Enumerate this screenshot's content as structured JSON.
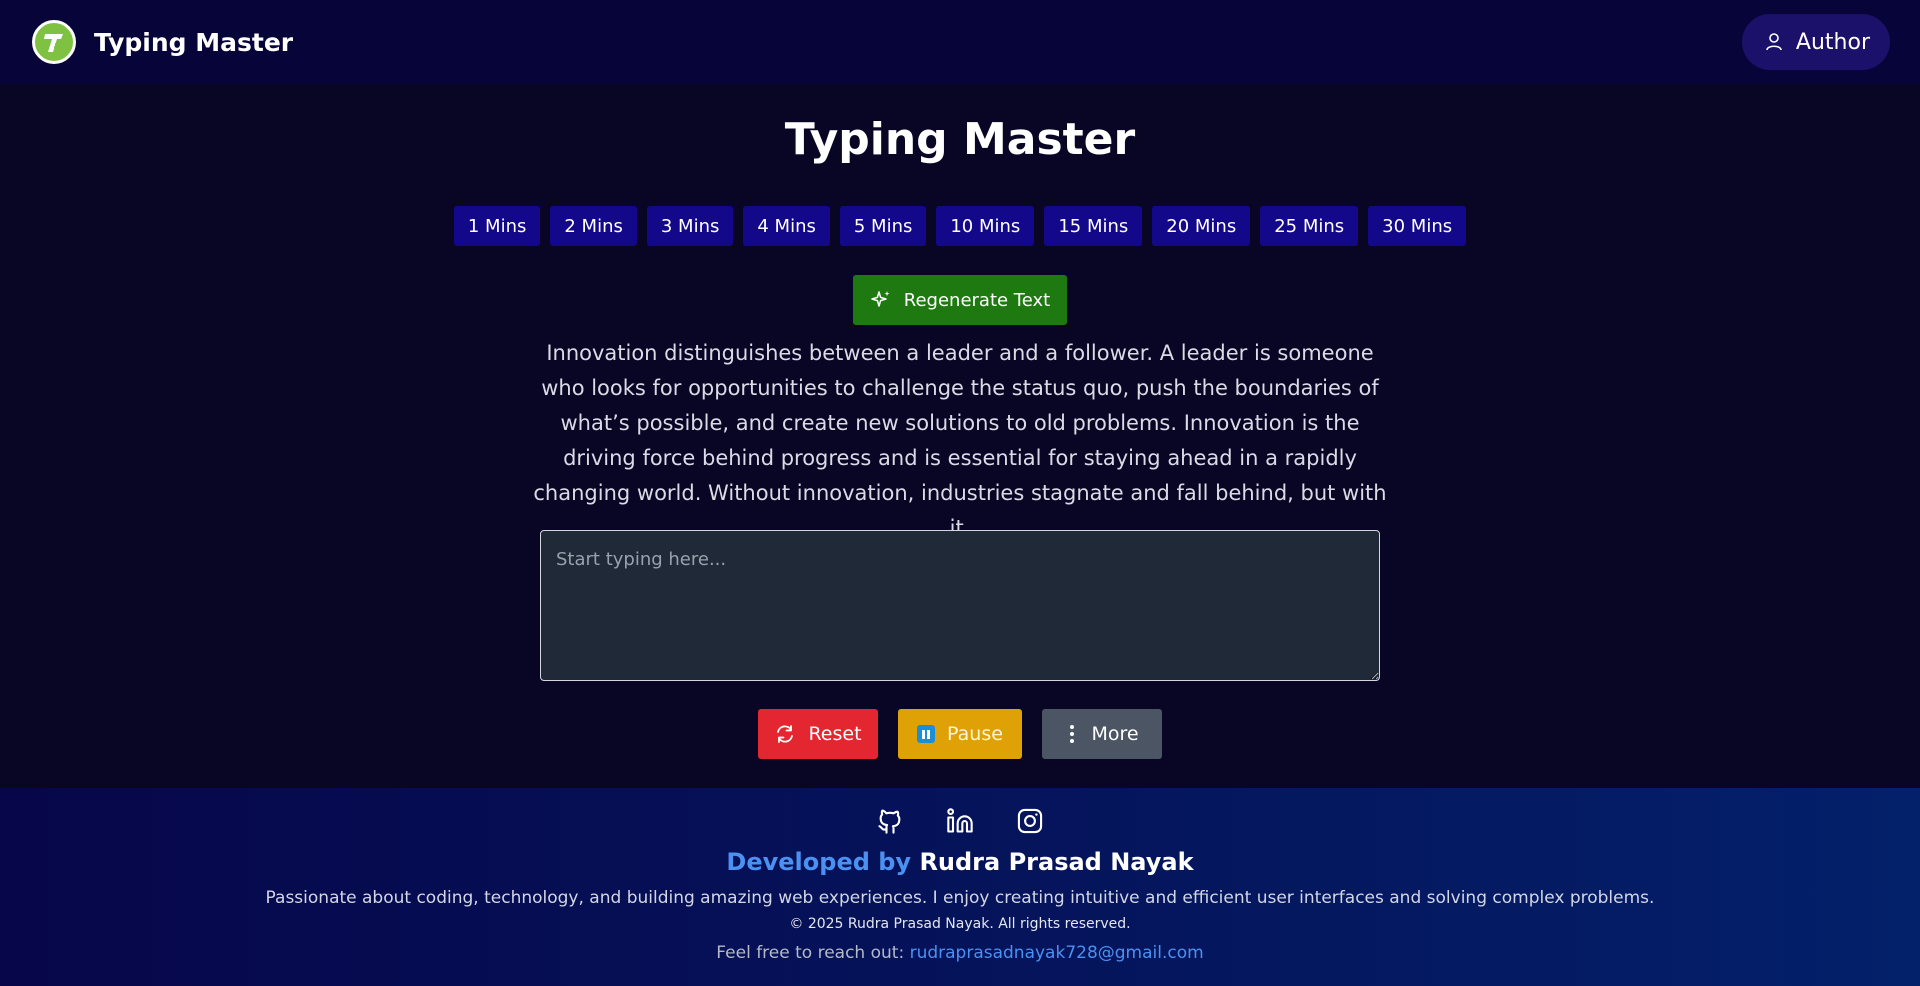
{
  "header": {
    "brand_name": "Typing Master",
    "logo_letter": "T",
    "author_label": "Author"
  },
  "main": {
    "title": "Typing Master",
    "durations": [
      "1 Mins",
      "2 Mins",
      "3 Mins",
      "4 Mins",
      "5 Mins",
      "10 Mins",
      "15 Mins",
      "20 Mins",
      "25 Mins",
      "30 Mins"
    ],
    "regenerate_label": "Regenerate Text",
    "passage": "Innovation distinguishes between a leader and a follower. A leader is someone who looks for opportunities to challenge the status quo, push the boundaries of what’s possible, and create new solutions to old problems. Innovation is the driving force behind progress and is essential for staying ahead in a rapidly changing world. Without innovation, industries stagnate and fall behind, but with it.",
    "input_placeholder": "Start typing here...",
    "input_value": "",
    "reset_label": "Reset",
    "pause_label": "Pause",
    "more_label": "More"
  },
  "footer": {
    "social_icons": [
      "github-icon",
      "linkedin-icon",
      "instagram-icon"
    ],
    "dev_prefix": "Developed by",
    "dev_name": "Rudra Prasad Nayak",
    "bio": "Passionate about coding, technology, and building amazing web experiences. I enjoy creating intuitive and efficient user interfaces and solving complex problems.",
    "copyright": "© 2025 Rudra Prasad Nayak. All rights reserved.",
    "contact_prefix": "Feel free to reach out:",
    "contact_email": "rudraprasadnayak728@gmail.com"
  },
  "colors": {
    "background": "#090625",
    "navbar": "#07043a",
    "duration_button": "#14088a",
    "regenerate_button": "#1e7a10",
    "reset_button": "#e3262f",
    "pause_button": "#e0a106",
    "more_button": "#4b5563",
    "accent_blue": "#4b91f1"
  }
}
